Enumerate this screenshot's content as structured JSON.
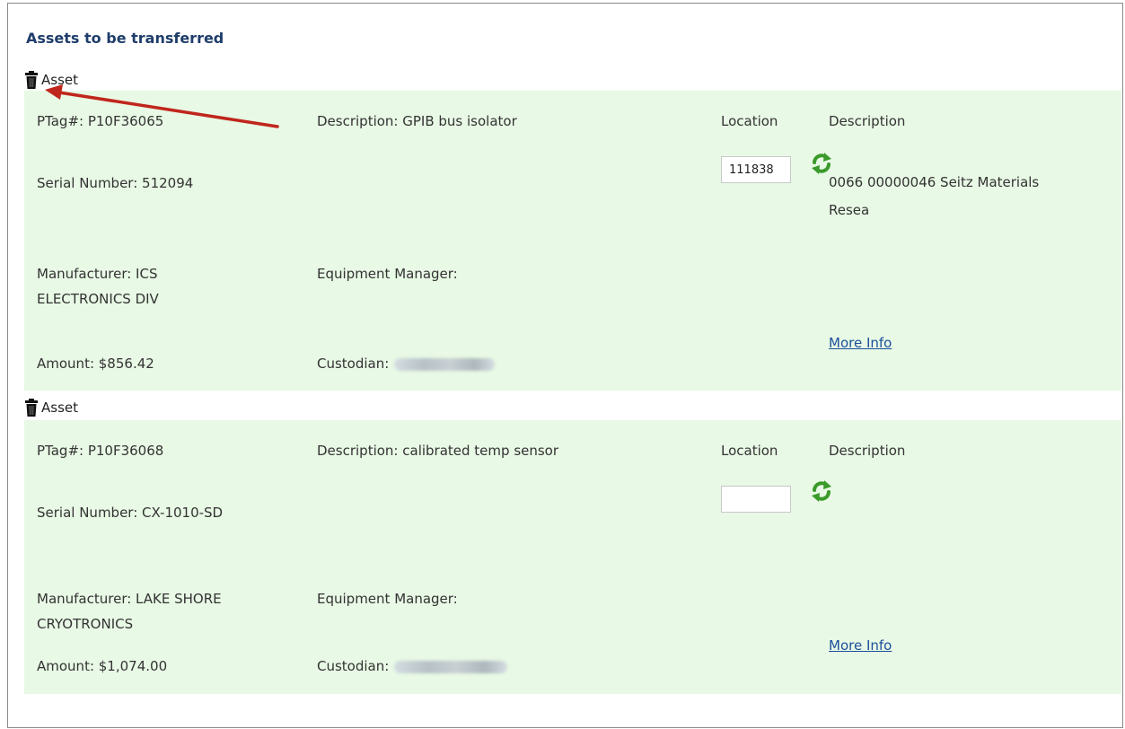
{
  "section_title": "Assets to be transferred",
  "asset_label": "Asset",
  "location_header": "Location",
  "description_header": "Description",
  "more_info_label": "More Info",
  "colors": {
    "title": "#1f3d6b",
    "card_background": "#e8f9e5",
    "link": "#1c4f9c",
    "annotation_arrow": "#c0261c",
    "refresh_icon": "#3a9a2a"
  },
  "icons": {
    "delete": "trash-icon",
    "refresh": "refresh-icon"
  },
  "assets": [
    {
      "ptag": "PTag#: P10F36065",
      "description": "Description: GPIB bus isolator",
      "serial": "Serial Number: 512094",
      "manufacturer_line1": "Manufacturer: ICS",
      "manufacturer_line2": "ELECTRONICS DIV",
      "equipment_manager": "Equipment Manager:",
      "amount": "Amount: $856.42",
      "custodian": "Custodian:",
      "location_value": "111838",
      "location_description_line1": "0066 00000046 Seitz Materials",
      "location_description_line2": "Resea"
    },
    {
      "ptag": "PTag#: P10F36068",
      "description": "Description: calibrated temp sensor",
      "serial": "Serial Number: CX-1010-SD",
      "manufacturer_line1": "Manufacturer: LAKE SHORE",
      "manufacturer_line2": "CRYOTRONICS",
      "equipment_manager": "Equipment Manager:",
      "amount": "Amount: $1,074.00",
      "custodian": "Custodian:",
      "location_value": "",
      "location_description_line1": "",
      "location_description_line2": ""
    }
  ]
}
